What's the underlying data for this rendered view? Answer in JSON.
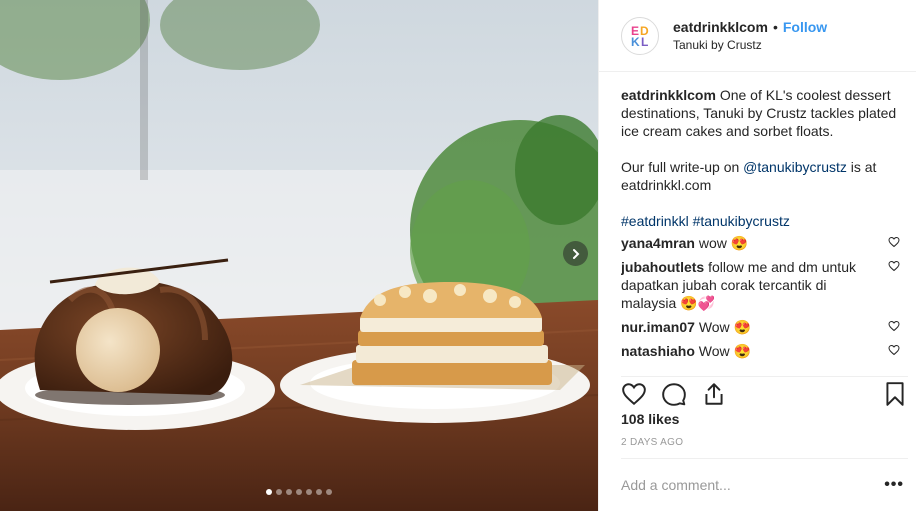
{
  "header": {
    "avatar_logo_text": "EDKL",
    "username": "eatdrinkklcom",
    "separator": "•",
    "follow_label": "Follow",
    "location": "Tanuki by Crustz"
  },
  "caption": {
    "username": "eatdrinkklcom",
    "text1": "One of KL's coolest dessert destinations, Tanuki by Crustz tackles plated ice cream cakes and sorbet floats.",
    "text2_before": "Our full write-up on",
    "mention": "@tanukibycrustz",
    "text2_after": "is at eatdrinkkl.com",
    "hashtag1": "#eatdrinkkl",
    "hashtag2": "#tanukibycrustz"
  },
  "comments": [
    {
      "username": "yana4mran",
      "text": "wow 😍"
    },
    {
      "username": "jubahoutlets",
      "text": "follow me and dm untuk dapatkan jubah corak tercantik di malaysia 😍💞"
    },
    {
      "username": "nur.iman07",
      "text": "Wow 😍"
    },
    {
      "username": "natashiaho",
      "text": "Wow 😍"
    }
  ],
  "likes": "108 likes",
  "timestamp": "2 DAYS AGO",
  "add_comment": {
    "placeholder": "Add a comment..."
  },
  "more_label": "•••",
  "carousel": {
    "total": 7,
    "active": 1
  },
  "icons": {
    "like": "heart-icon",
    "comment": "comment-icon",
    "share": "share-icon",
    "save": "bookmark-icon",
    "next": "chevron-right-icon"
  },
  "colors": {
    "accent": "#3897f0",
    "link": "#003569",
    "muted": "#999999"
  }
}
